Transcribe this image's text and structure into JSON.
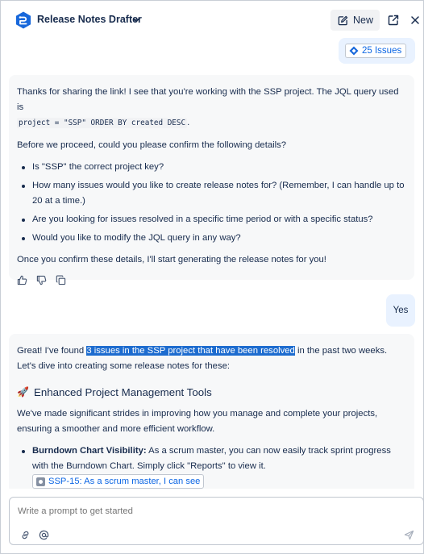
{
  "header": {
    "title": "Release Notes Drafter",
    "new_label": "New",
    "logo_icon": "release-notes-logo-icon",
    "chevron_icon": "chevron-down-icon",
    "open_icon": "open-in-new-window-icon",
    "close_icon": "close-icon"
  },
  "chat": {
    "issues_chip": "25 Issues",
    "message1": {
      "intro_a": "Thanks for sharing the link! I see that you're working with the SSP project. The JQL query used is",
      "query": "project = \"SSP\" ORDER BY created DESC",
      "query_end": ".",
      "confirm": "Before we proceed, could you please confirm the following details?",
      "bullets": [
        "Is \"SSP\" the correct project key?",
        "How many issues would you like to create release notes for? (Remember, I can handle up to 20 at a time.)",
        "Are you looking for issues resolved in a specific time period or with a specific status?",
        "Would you like to modify the JQL query in any way?"
      ],
      "closing": "Once you confirm these details, I'll start generating the release notes for you!"
    },
    "user_reply": "Yes",
    "message2": {
      "lead": "Great! I've found ",
      "highlight": "3 issues in the SSP project that have been resolved",
      "tail": " in the past two weeks. Let's dive into creating some release notes for these:",
      "heading_emoji": "🚀",
      "heading": "Enhanced Project Management Tools",
      "paragraph": "We've made significant strides in improving how you manage and complete your projects, ensuring a smoother and more efficient workflow.",
      "item_bold": "Burndown Chart Visibility:",
      "item_text": " As a scrum master, you can now easily track sprint progress with the Burndown Chart. Simply click \"Reports\" to view it. ",
      "issue_chip": "SSP-15: As a scrum master, I can see"
    }
  },
  "composer": {
    "placeholder": "Write a prompt to get started"
  },
  "colors": {
    "accent": "#0c66e4",
    "highlight": "#1d6ccf",
    "user_bubble": "#e9f2ff",
    "bot_card": "#f7f8f9"
  }
}
